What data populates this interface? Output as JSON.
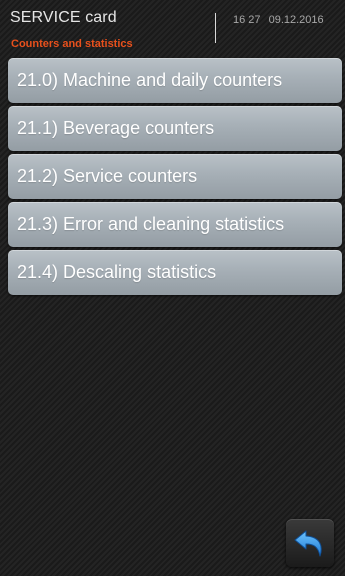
{
  "header": {
    "title": "SERVICE card",
    "subtitle": "Counters and statistics",
    "time": "16 27",
    "date": "09.12.2016"
  },
  "menu": {
    "items": [
      {
        "label": "21.0) Machine and daily counters"
      },
      {
        "label": "21.1) Beverage counters"
      },
      {
        "label": "21.2) Service counters"
      },
      {
        "label": "21.3) Error and cleaning statistics"
      },
      {
        "label": "21.4) Descaling statistics"
      }
    ]
  },
  "back_button": {
    "icon": "back-arrow-icon"
  },
  "colors": {
    "subtitle": "#e8501c",
    "button_top": "#b9c1c7",
    "button_bottom": "#949da4",
    "back_arrow": "#2f8fe0",
    "background": "#1e1e1e"
  }
}
